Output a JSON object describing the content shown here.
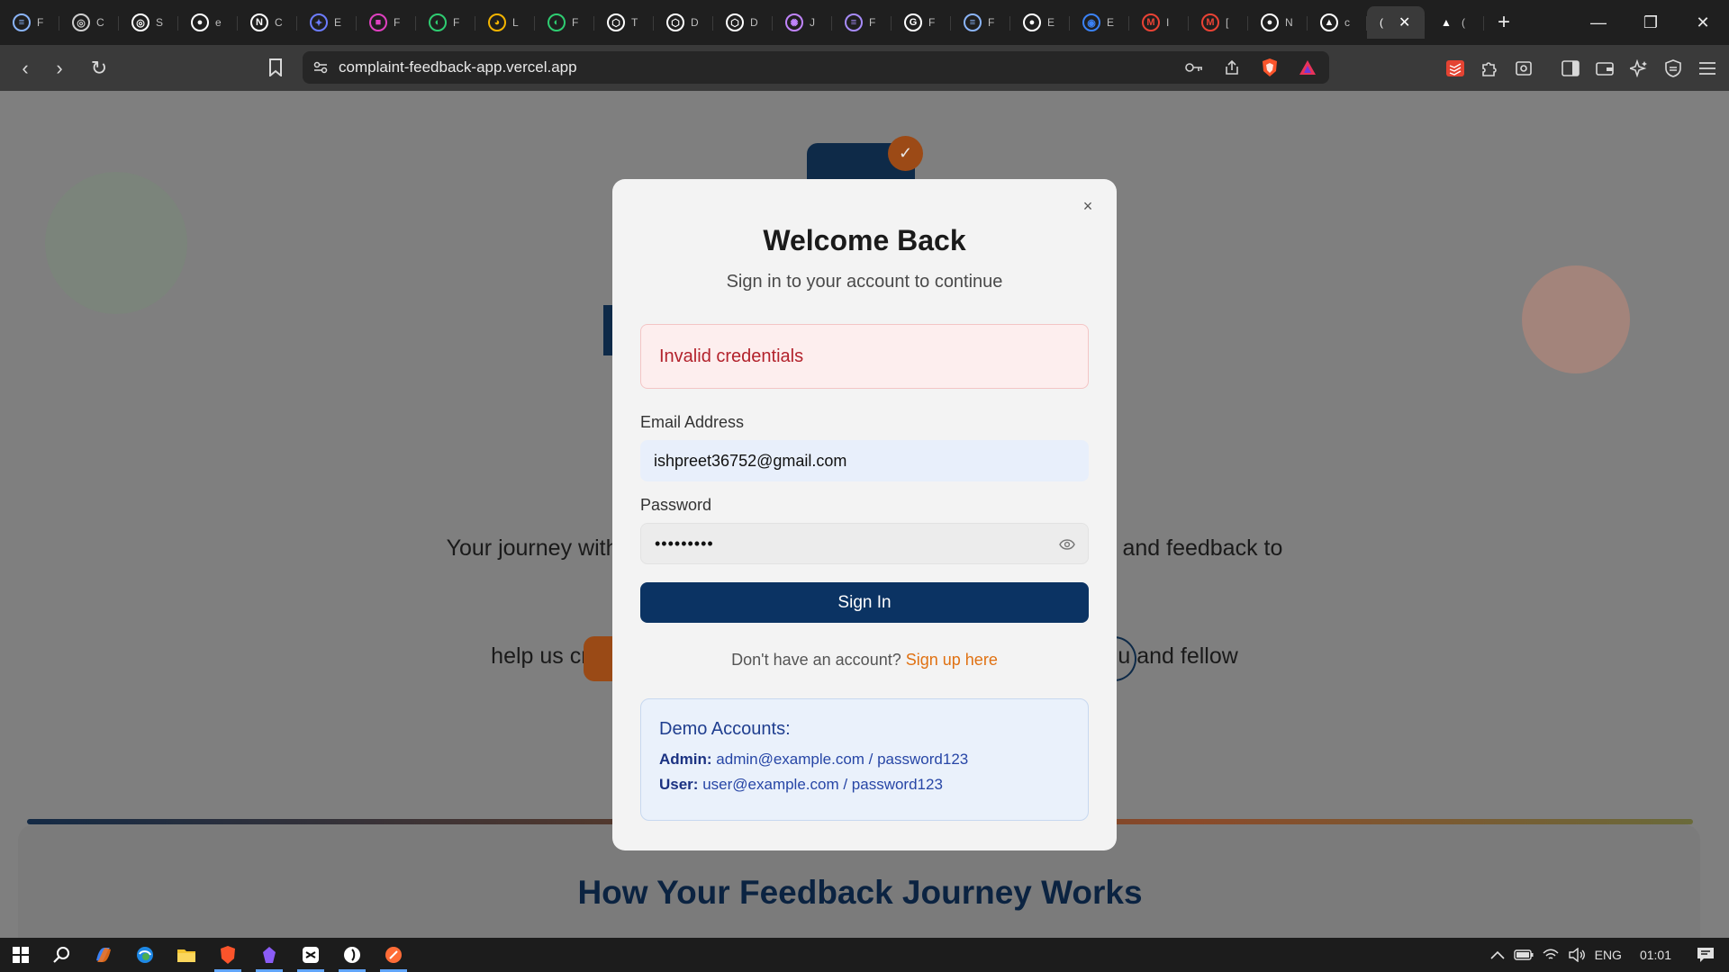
{
  "browser": {
    "tabs": [
      {
        "icon": "doc-icon",
        "glyph": "≡",
        "color": "#8ab4f8",
        "title": "F"
      },
      {
        "icon": "openai-icon",
        "glyph": "◎",
        "color": "#cfcfcf",
        "title": "C"
      },
      {
        "icon": "openai-icon",
        "glyph": "◎",
        "color": "#ffffff",
        "title": "S"
      },
      {
        "icon": "github-icon",
        "glyph": "●",
        "color": "#ffffff",
        "title": "e"
      },
      {
        "icon": "notion-icon",
        "glyph": "N",
        "color": "#ffffff",
        "title": "C"
      },
      {
        "icon": "bird-icon",
        "glyph": "✦",
        "color": "#6c7cff",
        "title": "E"
      },
      {
        "icon": "chat-icon",
        "glyph": "■",
        "color": "#e040c0",
        "title": "F"
      },
      {
        "icon": "leaf-icon",
        "glyph": "◐",
        "color": "#2ecc71",
        "title": "F"
      },
      {
        "icon": "color-wheel-icon",
        "glyph": "◕",
        "color": "#f4b400",
        "title": "L"
      },
      {
        "icon": "leaf-icon",
        "glyph": "◐",
        "color": "#2ecc71",
        "title": "F"
      },
      {
        "icon": "shield-icon",
        "glyph": "⬡",
        "color": "#ffffff",
        "title": "T"
      },
      {
        "icon": "shield-icon",
        "glyph": "⬡",
        "color": "#ffffff",
        "title": "D"
      },
      {
        "icon": "shield-icon",
        "glyph": "⬡",
        "color": "#ffffff",
        "title": "D"
      },
      {
        "icon": "spinner-icon",
        "glyph": "✺",
        "color": "#c084fc",
        "title": "J"
      },
      {
        "icon": "doc-icon",
        "glyph": "≡",
        "color": "#a78bfa",
        "title": "F"
      },
      {
        "icon": "google-icon",
        "glyph": "G",
        "color": "#ffffff",
        "title": "F"
      },
      {
        "icon": "doc-icon",
        "glyph": "≡",
        "color": "#8ab4f8",
        "title": "F"
      },
      {
        "icon": "github-icon",
        "glyph": "●",
        "color": "#ffffff",
        "title": "E"
      },
      {
        "icon": "globe-icon",
        "glyph": "◉",
        "color": "#3b82f6",
        "title": "E"
      },
      {
        "icon": "gmail-icon",
        "glyph": "M",
        "color": "#ea4335",
        "title": "I"
      },
      {
        "icon": "gmail-icon",
        "glyph": "M",
        "color": "#ea4335",
        "title": "["
      },
      {
        "icon": "github-icon",
        "glyph": "●",
        "color": "#ffffff",
        "title": "N"
      },
      {
        "icon": "triangle-icon",
        "glyph": "▲",
        "color": "#ffffff",
        "title": "c"
      }
    ],
    "active_tab": {
      "title": "(",
      "close": "✕"
    },
    "after_tab": {
      "icon": "triangle-icon",
      "glyph": "▲",
      "color": "#ffffff",
      "title": "("
    },
    "new_tab": "+",
    "window_controls": {
      "minimize": "—",
      "restore": "❐",
      "close": "✕"
    },
    "url": "complaint-feedback-app.vercel.app",
    "nav": {
      "back": "‹",
      "forward": "›",
      "reload": "↻",
      "bookmark": "⊓"
    }
  },
  "page": {
    "logo_check": "✓",
    "hero_text": "Your journey with                                                                                  and feedback to help us crea                                                                          u and fellow",
    "section_title": "How Your Feedback Journey Works"
  },
  "modal": {
    "close": "×",
    "title": "Welcome Back",
    "subtitle": "Sign in to your account to continue",
    "error": "Invalid credentials",
    "email_label": "Email Address",
    "email_value": "ishpreet36752@gmail.com",
    "password_label": "Password",
    "password_value": "•••••••••",
    "submit": "Sign In",
    "signup_prompt": "Don't have an account?",
    "signup_link": "Sign up here",
    "demo": {
      "title": "Demo Accounts:",
      "admin_label": "Admin:",
      "admin_creds": "admin@example.com / password123",
      "user_label": "User:",
      "user_creds": "user@example.com / password123"
    }
  },
  "taskbar": {
    "language": "ENG",
    "time": "01:01"
  }
}
